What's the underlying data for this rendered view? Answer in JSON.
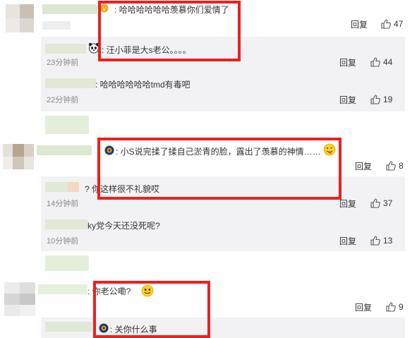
{
  "comments": [
    {
      "text": "哈哈哈哈哈哈羡慕你们爱情了",
      "time": "",
      "reply_label": "回复",
      "likes": "47",
      "replies": [
        {
          "text": "汪小菲是大s老公。。。。",
          "time": "23分钟前",
          "reply_label": "回复",
          "likes": "44"
        },
        {
          "text": "哈哈哈哈哈哈tmd有毒吧",
          "time": "22分钟前",
          "reply_label": "回复",
          "likes": "19"
        }
      ]
    },
    {
      "text": "小S说完揉了揉自己淤青的脸，露出了羡慕的神情……",
      "time": "",
      "reply_label": "回复",
      "likes": "8",
      "replies": [
        {
          "text": "你这样很不礼貌哎",
          "time": "14分钟前",
          "reply_label": "回复",
          "likes": "37"
        },
        {
          "text": "ky党今天还没死呢?",
          "time": "10分钟前",
          "reply_label": "回复",
          "likes": "13"
        }
      ]
    },
    {
      "text": "你老公嘞?",
      "time": "",
      "reply_label": "回复",
      "likes": "9",
      "replies": [
        {
          "text": "关你什么事",
          "time": "",
          "reply_label": "",
          "likes": ""
        }
      ]
    }
  ],
  "colors": {
    "highlight_box": "#ee1f1f",
    "panel_bg": "#f2f2f5",
    "muted_text": "#888888"
  },
  "icons": [
    "thumbs-up-icon",
    "panda-emoji-icon",
    "smile-emoji-icon",
    "tongue-emoji-icon",
    "verified-badge-icon"
  ]
}
